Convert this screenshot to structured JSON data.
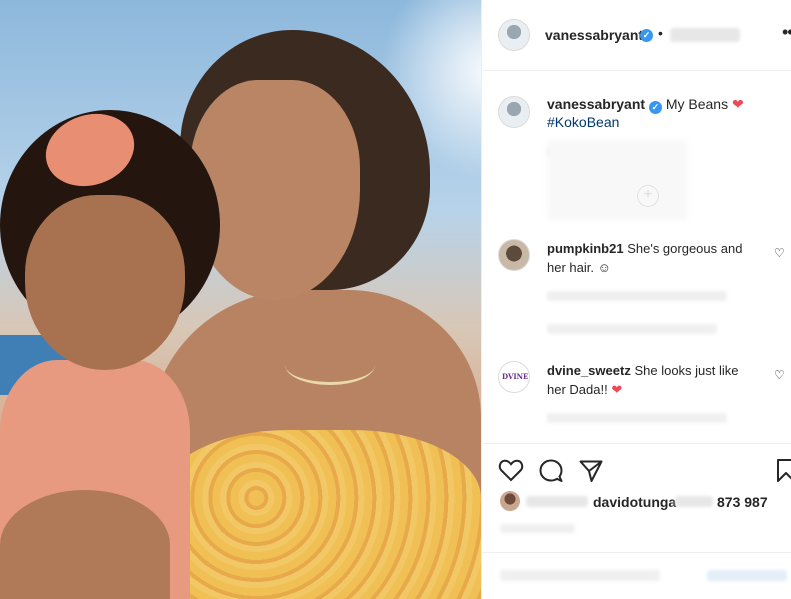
{
  "post": {
    "author": "vanessabryant",
    "caption": "My Beans",
    "hashtag": "#KokoBean"
  },
  "comments": [
    {
      "user": "pumpkinb21",
      "text": "She's gorgeous and her hair. ☺"
    },
    {
      "user": "dvine_sweetz",
      "text": "She looks just like her Dada!!"
    }
  ],
  "likes": {
    "liked_by_user": "davidotunga",
    "count": "873 987"
  },
  "icons": {
    "verified": "verified-badge-icon",
    "more": "more-options-icon",
    "heart": "heart-icon",
    "comment": "comment-icon",
    "share": "share-icon",
    "save": "bookmark-icon"
  },
  "colors": {
    "verified": "#3897f0",
    "red_heart": "#ed4956",
    "hashtag": "#00376b"
  }
}
